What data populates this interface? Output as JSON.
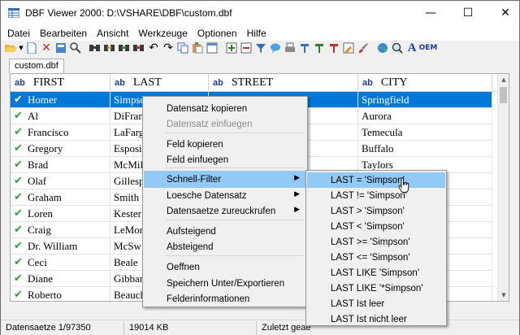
{
  "window": {
    "title": "DBF Viewer 2000: D:\\VSHARE\\DBF\\custom.dbf",
    "minimize_glyph": "—",
    "maximize_glyph": "☐",
    "close_glyph": "✕"
  },
  "menu": [
    "Datei",
    "Bearbeiten",
    "Ansicht",
    "Werkzeuge",
    "Optionen",
    "Hilfe"
  ],
  "toolbar": {
    "icons": [
      "open-folder-icon",
      "dropdown-arrow-icon",
      "new-file-icon",
      "delete-icon",
      "copy-record-icon",
      "find-icon",
      "find-next-icon",
      "replace-icon",
      "filter-icon",
      "sort-icon",
      "undo-icon",
      "redo-icon",
      "copy-icon",
      "paste-icon",
      "structure-icon",
      "import-icon",
      "export-icon",
      "sql-icon",
      "comment-icon",
      "print-icon",
      "columns-icon",
      "fields-icon",
      "bookmark-icon",
      "edit-icon",
      "brush-icon",
      "web-icon",
      "preview-icon",
      "font-icon",
      "oem-icon"
    ],
    "font_glyph": "A",
    "oem_label": "OEM"
  },
  "tab": {
    "label": "custom.dbf"
  },
  "grid": {
    "type_badge": "ab",
    "columns": [
      "FIRST",
      "LAST",
      "STREET",
      "CITY"
    ],
    "rows": [
      {
        "first": "Homer",
        "last": "Simpson",
        "street": "",
        "city": "Springfield"
      },
      {
        "first": "Al",
        "last": "DiFran",
        "street": "",
        "city": "Aurora"
      },
      {
        "first": "Francisco",
        "last": "LaFarg",
        "street": "",
        "city": "Temecula"
      },
      {
        "first": "Gregory",
        "last": "Esposi",
        "street": "",
        "city": "Buffalo"
      },
      {
        "first": "Brad",
        "last": "McMil",
        "street": "",
        "city": "Taylors"
      },
      {
        "first": "Olaf",
        "last": "Gillesp",
        "street": "",
        "city": ""
      },
      {
        "first": "Graham",
        "last": "Smith",
        "street": "",
        "city": ""
      },
      {
        "first": "Loren",
        "last": "Kester",
        "street": "",
        "city": ""
      },
      {
        "first": "Craig",
        "last": "LeMon",
        "street": "",
        "city": ""
      },
      {
        "first": "Dr. William",
        "last": "McSw",
        "street": "",
        "city": ""
      },
      {
        "first": "Ceci",
        "last": "Beale",
        "street": "",
        "city": ""
      },
      {
        "first": "Diane",
        "last": "Gibban",
        "street": "",
        "city": ""
      },
      {
        "first": "Roberto",
        "last": "Beauch",
        "street": "",
        "city": ""
      }
    ],
    "selected_row": 0
  },
  "context_menu": {
    "items": [
      {
        "label": "Datensatz kopieren",
        "disabled": false
      },
      {
        "label": "Datensatz einfuegen",
        "disabled": true
      },
      {
        "label": "Feld kopieren",
        "disabled": false
      },
      {
        "label": "Feld einfuegen",
        "disabled": false
      },
      {
        "label": "Schnell-Filter",
        "disabled": false,
        "submenu": true
      },
      {
        "label": "Loesche Datensatz",
        "disabled": false,
        "submenu": true
      },
      {
        "label": "Datensaetze zureuckrufen",
        "disabled": false,
        "submenu": true
      },
      {
        "label": "Aufsteigend",
        "disabled": false
      },
      {
        "label": "Absteigend",
        "disabled": false
      },
      {
        "label": "Oeffnen",
        "disabled": false
      },
      {
        "label": "Speichern Unter/Exportieren",
        "disabled": false
      },
      {
        "label": "Felderinformationen",
        "disabled": false
      }
    ],
    "submenu_arrow": "▶"
  },
  "filter_submenu": [
    "LAST = 'Simpson'",
    "LAST != 'Simpson'",
    "LAST > 'Simpson'",
    "LAST < 'Simpson'",
    "LAST >= 'Simpson'",
    "LAST <= 'Simpson'",
    "LAST LIKE 'Simpson'",
    "LAST LIKE '*Simpson'",
    "LAST Ist leer",
    "LAST Ist nicht leer"
  ],
  "status": {
    "records": "Datensaetze 1/97350",
    "size": "19014 KB",
    "modified": "Zuletzt geae"
  },
  "colors": {
    "check": "#2e9e3a",
    "selection": "#0078d7",
    "menu_hover": "#91c9f7"
  }
}
